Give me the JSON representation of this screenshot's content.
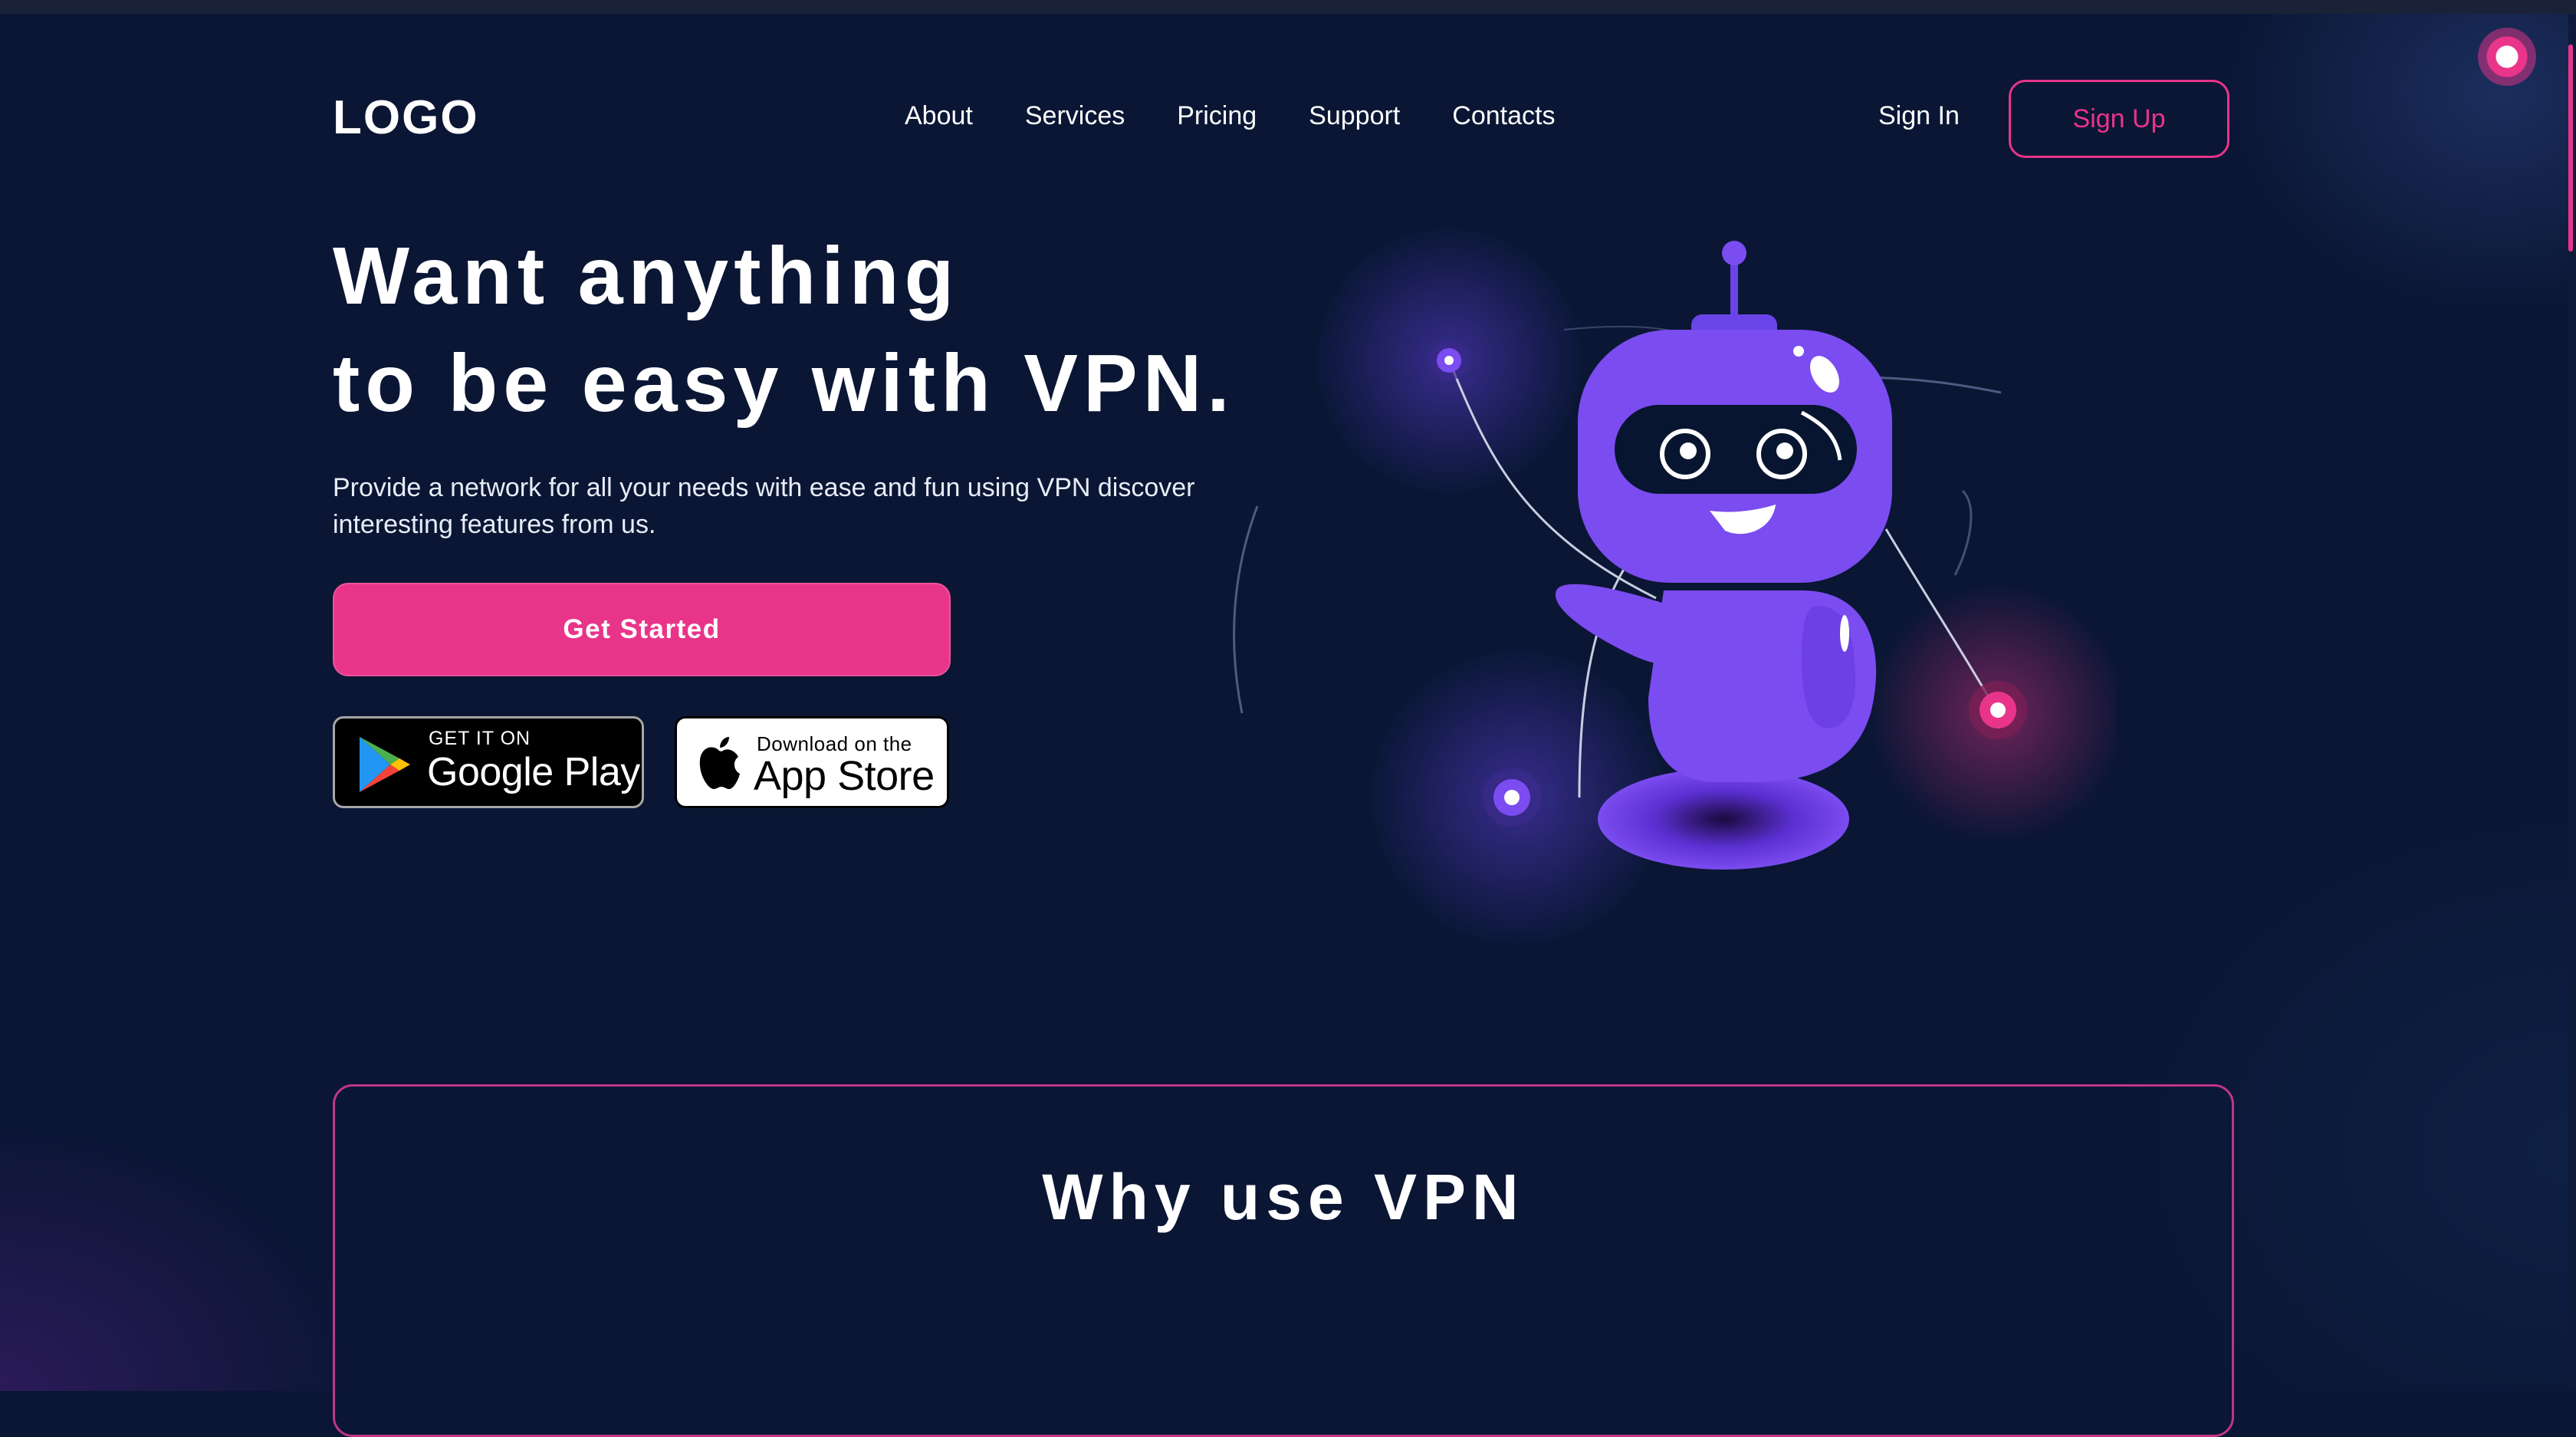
{
  "header": {
    "logo": "LOGO",
    "nav": [
      "About",
      "Services",
      "Pricing",
      "Support",
      "Contacts"
    ],
    "sign_in": "Sign In",
    "sign_up": "Sign Up"
  },
  "hero": {
    "title_line1": "Want anything",
    "title_line2": "to be easy with VPN.",
    "subtitle": "Provide a network for all your needs with ease and fun using VPN discover interesting features from us.",
    "cta": "Get Started",
    "google_play": {
      "small": "GET IT ON",
      "big": "Google Play"
    },
    "app_store": {
      "small": "Download on the",
      "big": "App Store"
    }
  },
  "why": {
    "title": "Why use VPN"
  },
  "colors": {
    "background": "#0a1634",
    "accent": "#e8358a",
    "robot": "#7b4cf0"
  },
  "icons": [
    "google-play-icon",
    "apple-icon",
    "robot-illustration"
  ]
}
